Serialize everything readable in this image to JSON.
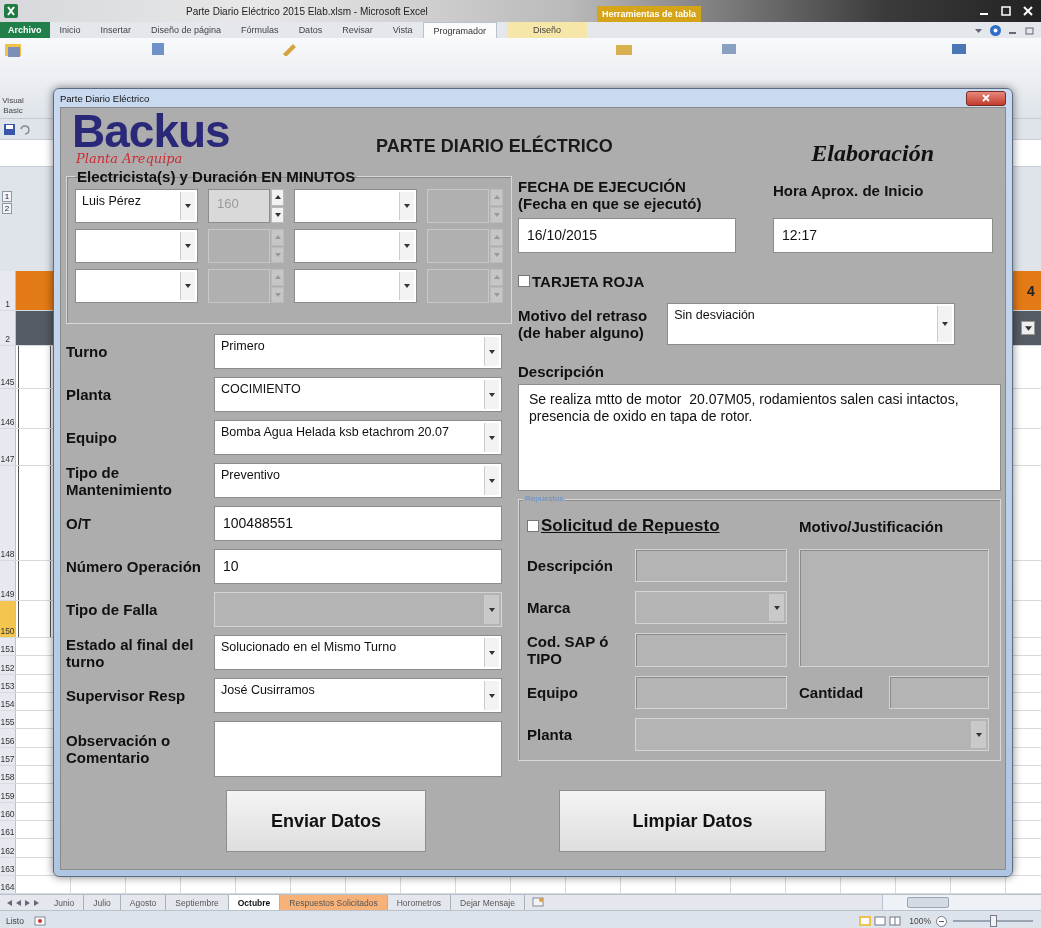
{
  "excel": {
    "title": "Parte Diario Eléctrico 2015 Elab.xlsm - Microsoft Excel",
    "context_group": "Herramientas de tabla",
    "tabs": [
      {
        "label": "Archivo",
        "kind": "file",
        "selected": false
      },
      {
        "label": "Inicio",
        "kind": "tab",
        "selected": false
      },
      {
        "label": "Insertar",
        "kind": "tab",
        "selected": false
      },
      {
        "label": "Diseño de página",
        "kind": "tab",
        "selected": false
      },
      {
        "label": "Fórmulas",
        "kind": "tab",
        "selected": false
      },
      {
        "label": "Datos",
        "kind": "tab",
        "selected": false
      },
      {
        "label": "Revisar",
        "kind": "tab",
        "selected": false
      },
      {
        "label": "Vista",
        "kind": "tab",
        "selected": false
      },
      {
        "label": "Programador",
        "kind": "tab",
        "selected": true
      },
      {
        "label": "Diseño",
        "kind": "context",
        "selected": false
      }
    ],
    "ribbon_button": "Visual Basic",
    "outline_levels": [
      "1",
      "2"
    ],
    "rows": [
      {
        "label": "1",
        "kind": "title",
        "selected": false
      },
      {
        "label": "2",
        "kind": "filter",
        "selected": false
      },
      {
        "label": "145",
        "kind": "data",
        "selected": false
      },
      {
        "label": "146",
        "kind": "data",
        "selected": false
      },
      {
        "label": "147",
        "kind": "data",
        "selected": false
      },
      {
        "label": "148",
        "kind": "data",
        "selected": false
      },
      {
        "label": "149",
        "kind": "data",
        "selected": false
      },
      {
        "label": "150",
        "kind": "data",
        "selected": true
      },
      {
        "label": "151",
        "kind": "empty",
        "selected": false
      },
      {
        "label": "152",
        "kind": "empty",
        "selected": false
      },
      {
        "label": "153",
        "kind": "empty",
        "selected": false
      },
      {
        "label": "154",
        "kind": "empty",
        "selected": false
      },
      {
        "label": "155",
        "kind": "empty",
        "selected": false
      },
      {
        "label": "156",
        "kind": "empty",
        "selected": false
      },
      {
        "label": "157",
        "kind": "empty",
        "selected": false
      },
      {
        "label": "158",
        "kind": "empty",
        "selected": false
      },
      {
        "label": "159",
        "kind": "empty",
        "selected": false
      },
      {
        "label": "160",
        "kind": "empty",
        "selected": false
      },
      {
        "label": "161",
        "kind": "empty",
        "selected": false
      },
      {
        "label": "162",
        "kind": "empty",
        "selected": false
      },
      {
        "label": "163",
        "kind": "empty",
        "selected": false
      },
      {
        "label": "164",
        "kind": "empty",
        "selected": false
      }
    ],
    "title_cell": "4",
    "sheet_tabs": [
      {
        "label": "Junio",
        "selected": false
      },
      {
        "label": "Julio",
        "selected": false
      },
      {
        "label": "Agosto",
        "selected": false
      },
      {
        "label": "Septiembre",
        "selected": false
      },
      {
        "label": "Octubre",
        "selected": true
      },
      {
        "label": "Respuestos Solicitados",
        "selected": false,
        "color": "#f7b27a"
      },
      {
        "label": "Horometros",
        "selected": false
      },
      {
        "label": "Dejar Mensaje",
        "selected": false
      }
    ],
    "status": "Listo",
    "zoom": "100%",
    "zoom_slider": {
      "level": 0.5
    }
  },
  "form": {
    "window_title": "Parte Diario Eléctrico",
    "logo": {
      "name": "Backus",
      "subtitle": "Planta Arequipa"
    },
    "title": "PARTE DIARIO ELÉCTRICO",
    "stage": "Elaboración",
    "crew": {
      "legend": "Electricista(s) y Duración EN MINUTOS",
      "rows": [
        {
          "name": "Luis Pérez",
          "minutes": "160",
          "minutes_disabled": false
        },
        {
          "minutes_disabled": true
        },
        {
          "minutes_disabled": true
        },
        {
          "minutes_disabled": true
        },
        {
          "minutes_disabled": true
        },
        {
          "minutes_disabled": true
        }
      ]
    },
    "fields": [
      {
        "label": "Turno",
        "kind": "combo",
        "value": "Primero",
        "disabled": false
      },
      {
        "label": "Planta",
        "kind": "combo",
        "value": "COCIMIENTO",
        "disabled": false
      },
      {
        "label": "Equipo",
        "kind": "combo",
        "value": "Bomba Agua Helada ksb etachrom 20.07",
        "disabled": false
      },
      {
        "label": "Tipo de Mantenimiento",
        "kind": "combo",
        "value": "Preventivo",
        "disabled": false
      },
      {
        "label": "O/T",
        "kind": "text",
        "value": "100488551",
        "disabled": false
      },
      {
        "label": "Número Operación",
        "kind": "text",
        "value": "10",
        "disabled": false
      },
      {
        "label": "Tipo de Falla",
        "kind": "combo",
        "disabled": true
      },
      {
        "label": "Estado al final del turno",
        "kind": "combo",
        "value": "Solucionado en el Mismo Turno",
        "disabled": false
      },
      {
        "label": "Supervisor Resp",
        "kind": "combo",
        "value": "José Cusirramos",
        "disabled": false
      },
      {
        "label": "Observación o Comentario",
        "kind": "textarea",
        "disabled": false
      }
    ],
    "date": {
      "label": "FECHA DE EJECUCIÓN",
      "hint": "(Fecha en que se ejecutó)",
      "value": "16/10/2015"
    },
    "start_time": {
      "label": "Hora Aprox. de Inicio",
      "value": "12:17"
    },
    "red_card": {
      "label": "TARJETA ROJA",
      "checked": false
    },
    "delay": {
      "label": "Motivo del retraso",
      "hint": "(de haber alguno)",
      "value": "Sin desviación"
    },
    "description": {
      "label": "Descripción",
      "value": "Se realiza mtto de motor  20.07M05, rodamientos salen casi intactos, presencia de oxido en tapa de rotor."
    },
    "parts": {
      "legend": "Repuestos",
      "request": {
        "label": "Solicitud de Repuesto",
        "checked": false
      },
      "reason": {
        "label": "Motivo/Justificación",
        "disabled": true
      },
      "fields": [
        {
          "label": "Descripción",
          "kind": "text",
          "disabled": true
        },
        {
          "label": "Marca",
          "kind": "combo",
          "disabled": true
        },
        {
          "label": "Cod. SAP ó TIPO",
          "kind": "text",
          "disabled": true
        },
        {
          "label": "Equipo",
          "kind": "text",
          "disabled": true
        },
        {
          "label": "Planta",
          "kind": "combo",
          "disabled": true
        }
      ],
      "quantity": {
        "label": "Cantidad",
        "disabled": true
      }
    },
    "buttons": [
      {
        "label": "Enviar Datos"
      },
      {
        "label": "Limpiar Datos"
      }
    ]
  }
}
